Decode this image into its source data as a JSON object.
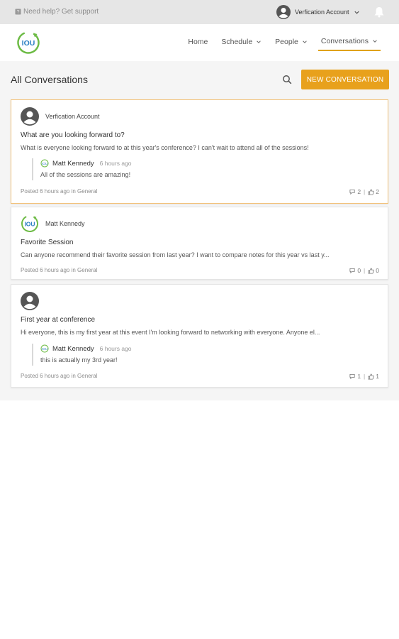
{
  "topbar": {
    "help_text": "Need help? Get support",
    "account_name": "Verfication Account"
  },
  "nav": {
    "items": [
      {
        "label": "Home"
      },
      {
        "label": "Schedule"
      },
      {
        "label": "People"
      },
      {
        "label": "Conversations"
      }
    ],
    "active": "Conversations"
  },
  "logo_text": "IOU",
  "page": {
    "title": "All Conversations",
    "new_button": "NEW CONVERSATION"
  },
  "conversations": [
    {
      "author": "Verfication Account",
      "title": "What are you looking forward to?",
      "body": "What is everyone looking forward to at this year's conference? I can't wait to attend all of the sessions!",
      "reply": {
        "author": "Matt Kennedy",
        "time": "6 hours ago",
        "text": "All of the sessions are amazing!"
      },
      "meta": "Posted 6 hours ago in General",
      "comments": "2",
      "likes": "2"
    },
    {
      "author": "Matt Kennedy",
      "title": "Favorite Session",
      "body": "Can anyone recommend their favorite session from last year? I want to compare notes for this year vs last y...",
      "meta": "Posted 6 hours ago in General",
      "comments": "0",
      "likes": "0"
    },
    {
      "author": "",
      "title": "First year at conference",
      "body": "Hi everyone, this is my first year at this event I'm looking forward to networking with everyone. Anyone el...",
      "reply": {
        "author": "Matt Kennedy",
        "time": "6 hours ago",
        "text": "this is actually my 3rd year!"
      },
      "meta": "Posted 6 hours ago in General",
      "comments": "1",
      "likes": "1"
    }
  ],
  "colors": {
    "accent": "#e8a11c",
    "logo_green": "#6dbb45",
    "logo_blue": "#2b7fc3",
    "topbar_bg": "#e6e6e6",
    "page_bg": "#f5f5f5"
  }
}
